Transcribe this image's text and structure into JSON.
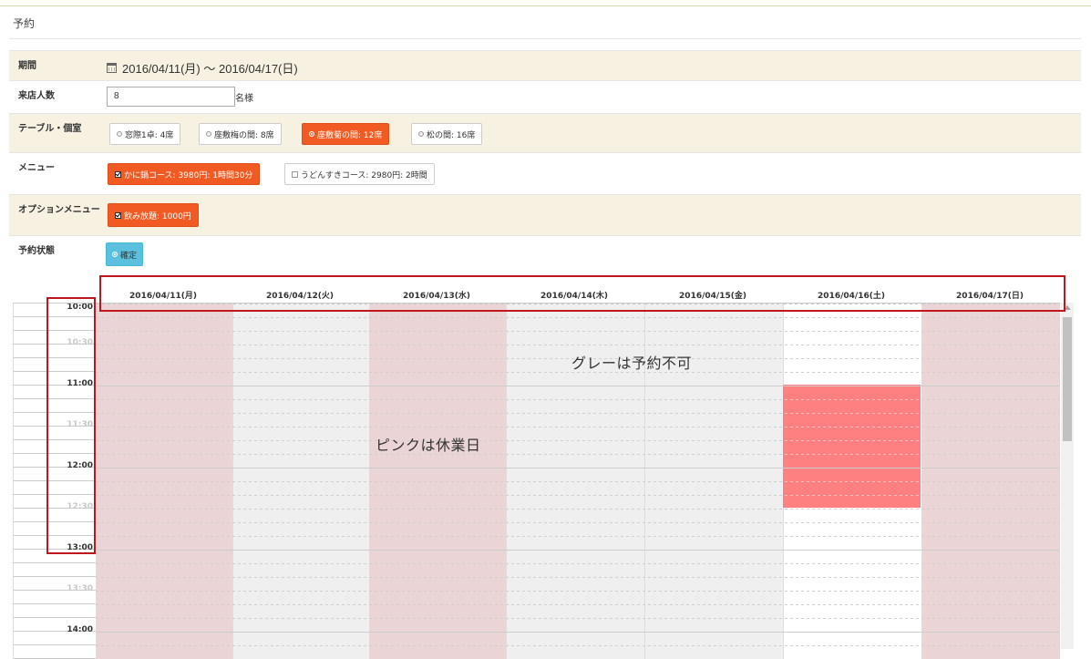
{
  "page": {
    "title": "予約"
  },
  "form": {
    "period": {
      "label": "期間",
      "value": "2016/04/11(月) 〜 2016/04/17(日)"
    },
    "guests": {
      "label": "来店人数",
      "value": "8",
      "unit": "名様"
    },
    "table": {
      "label": "テーブル・個室",
      "options": [
        {
          "label": "窓際1卓: 4席",
          "selected": false
        },
        {
          "label": "座敷梅の間: 8席",
          "selected": false
        },
        {
          "label": "座敷菊の間: 12席",
          "selected": true
        },
        {
          "label": "松の間: 16席",
          "selected": false
        }
      ]
    },
    "menu": {
      "label": "メニュー",
      "options": [
        {
          "label": "かに鍋コース: 3980円: 1時間30分",
          "checked": true
        },
        {
          "label": "うどんすきコース: 2980円: 2時間",
          "checked": false
        }
      ]
    },
    "option_menu": {
      "label": "オプションメニュー",
      "options": [
        {
          "label": "飲み放題: 1000円",
          "checked": true
        }
      ]
    },
    "status": {
      "label": "予約状態",
      "value": "確定"
    }
  },
  "calendar": {
    "days": [
      {
        "label": "2016/04/11(月)",
        "state": "holiday"
      },
      {
        "label": "2016/04/12(火)",
        "state": "unavailable"
      },
      {
        "label": "2016/04/13(水)",
        "state": "holiday"
      },
      {
        "label": "2016/04/14(木)",
        "state": "unavailable"
      },
      {
        "label": "2016/04/15(金)",
        "state": "unavailable"
      },
      {
        "label": "2016/04/16(土)",
        "state": "open"
      },
      {
        "label": "2016/04/17(日)",
        "state": "holiday"
      }
    ],
    "times": [
      "10:00",
      "10:30",
      "11:00",
      "11:30",
      "12:00",
      "12:30",
      "13:00",
      "13:30",
      "14:00"
    ],
    "booking": {
      "day": "2016/04/16(土)",
      "start": "11:00",
      "end": "12:30"
    },
    "annotations": {
      "gray": "グレーは予約不可",
      "pink": "ピンクは休業日"
    }
  },
  "colors": {
    "accent": "#f15a22",
    "status_blue": "#5bc0de",
    "holiday_pink": "#ead4d6",
    "unavailable_gray": "#efefef",
    "booked": "#ff8080",
    "highlight_red": "#c0161d",
    "form_shade": "#f6f1e1"
  }
}
